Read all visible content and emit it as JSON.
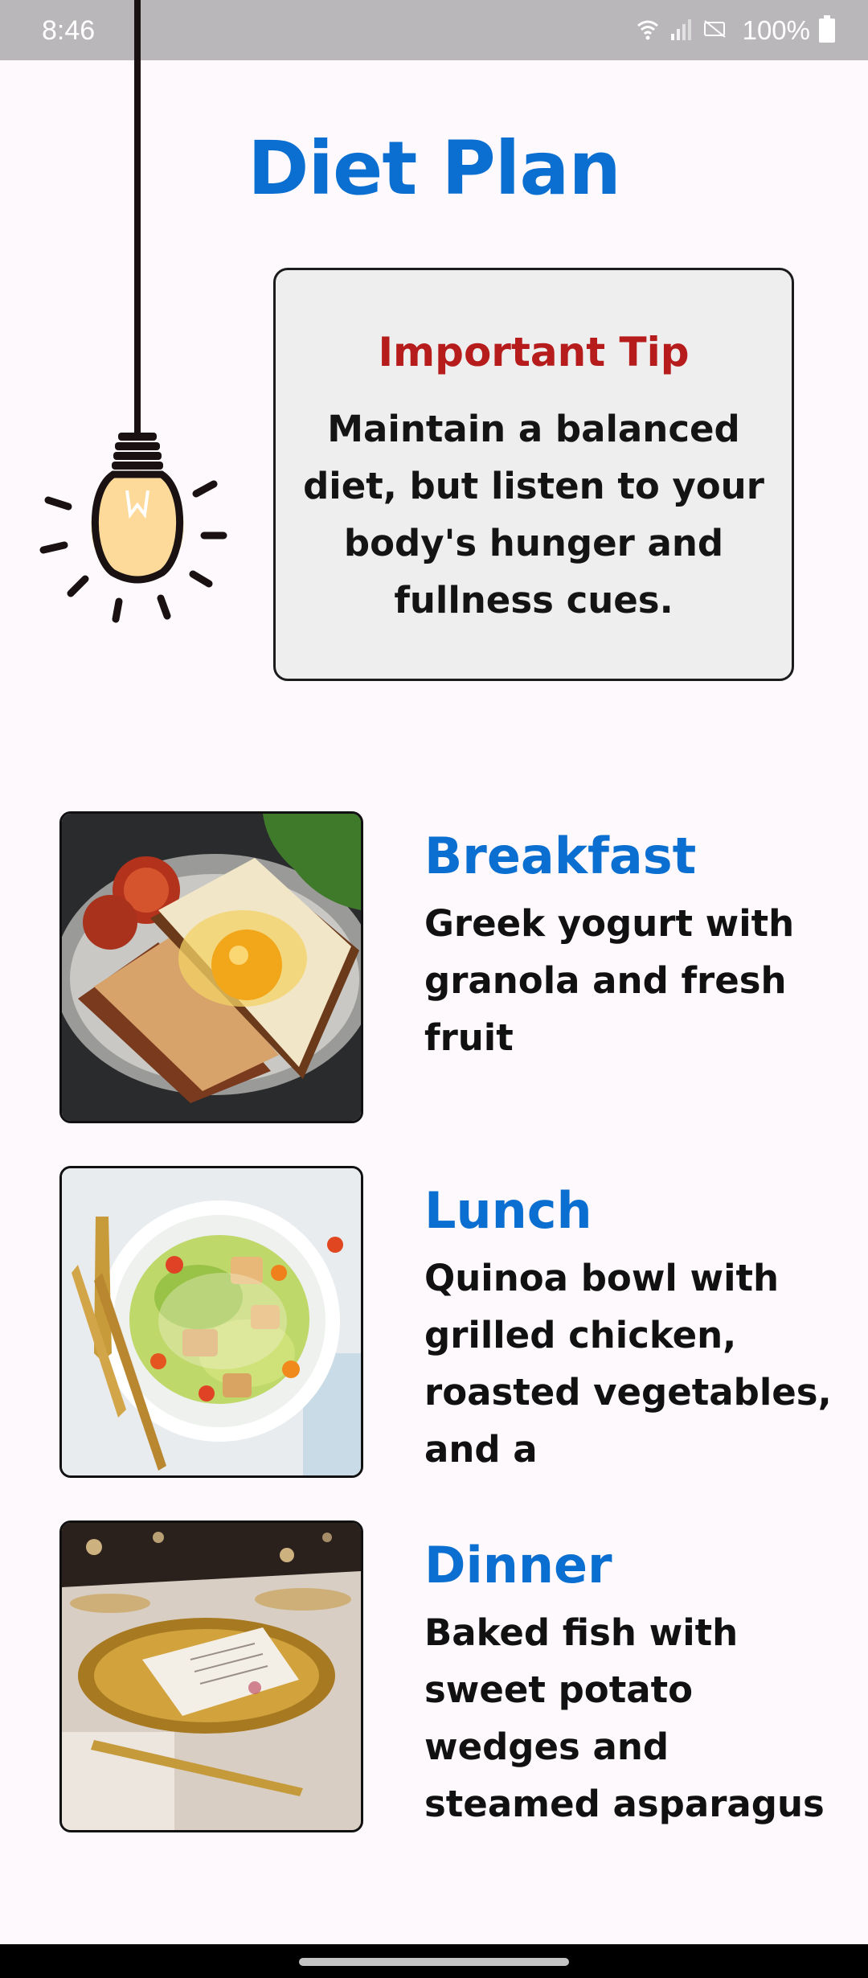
{
  "status_bar": {
    "time": "8:46",
    "battery": "100%",
    "icons": [
      "wifi-icon",
      "signal-icon",
      "no-sim-icon",
      "battery-icon"
    ]
  },
  "page": {
    "title": "Diet Plan"
  },
  "tip": {
    "title": "Important Tip",
    "text": "Maintain a balanced diet, but listen to your body's hunger and fullness cues."
  },
  "meals": [
    {
      "title": "Breakfast",
      "description": "Greek yogurt with granola and fresh fruit",
      "image": "fried-egg-toast-photo"
    },
    {
      "title": "Lunch",
      "description": "Quinoa bowl with grilled chicken, roasted vegetables, and a",
      "image": "caesar-salad-photo"
    },
    {
      "title": "Dinner",
      "description": "Baked fish with sweet potato wedges and steamed asparagus",
      "image": "dinner-table-photo"
    }
  ],
  "colors": {
    "title": "#0a6fd0",
    "tip_title": "#b71c1c",
    "tip_background": "#eeeeee",
    "page_background": "#fdf9fc",
    "status_bar": "#b9b7b9"
  }
}
